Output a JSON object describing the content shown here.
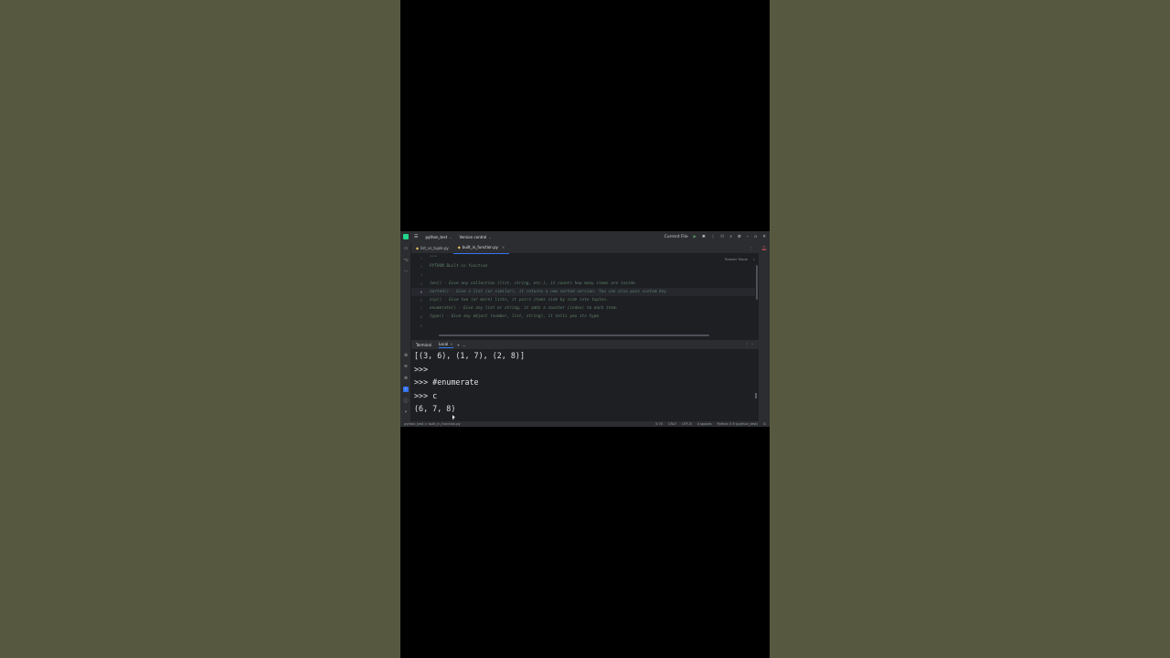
{
  "titlebar": {
    "project": "python_test",
    "version_control": "Version control",
    "run_config": "Current File"
  },
  "tabs": [
    {
      "label": "list_vs_tuple.py"
    },
    {
      "label": "built_in_function.py"
    }
  ],
  "editor": {
    "reader_mode": "Reader Mode",
    "lines": [
      {
        "n": "1",
        "text": "\"\"\""
      },
      {
        "n": "2",
        "text": "    PYTHON Built-in function"
      },
      {
        "n": "3",
        "text": ""
      },
      {
        "n": "4",
        "text": "    len() - Give any collection (list, string, etc.), it counts how many items are inside."
      },
      {
        "n": "5",
        "text": "    sorted() - Give a list (or similar), it returns a new sorted version. You can also pass custom key"
      },
      {
        "n": "6",
        "text": "    zip() - Give two (or more) lists, it pairs items side by side into tuples."
      },
      {
        "n": "7",
        "text": "    enumerate() - Give any list or string, it adds a counter (index) to each item."
      },
      {
        "n": "8",
        "text": "    type() - Give any object (number, list, string), it tells you its type."
      },
      {
        "n": "9",
        "text": ""
      }
    ]
  },
  "terminal": {
    "title": "Terminal",
    "tab": "Local",
    "lines": [
      "[(3, 6), (1, 7), (2, 8)]",
      ">>>",
      ">>> #enumerate",
      ">>> c",
      "(6, 7, 8)"
    ]
  },
  "status": {
    "breadcrumb": "python_test > built_in_function.py",
    "position": "5:70",
    "line_sep": "CRLF",
    "encoding": "UTF-8",
    "indent": "4 spaces",
    "interpreter": "Python 3.9 (python_test)"
  }
}
